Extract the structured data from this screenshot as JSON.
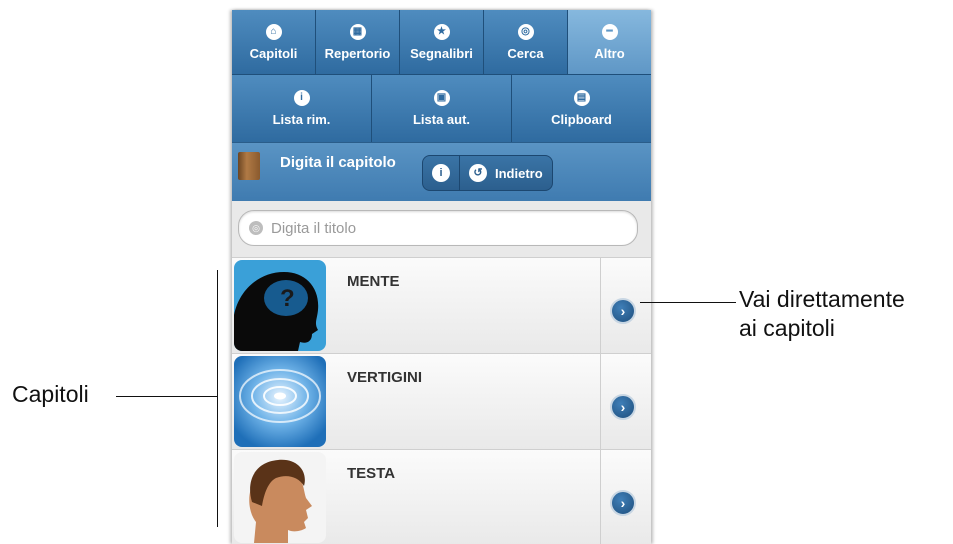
{
  "tabs_row1": [
    {
      "label": "Capitoli",
      "icon": "home-icon",
      "glyph": "⌂"
    },
    {
      "label": "Repertorio",
      "icon": "grid-icon",
      "glyph": "▦"
    },
    {
      "label": "Segnalibri",
      "icon": "star-icon",
      "glyph": "★"
    },
    {
      "label": "Cerca",
      "icon": "search-icon",
      "glyph": "◎"
    },
    {
      "label": "Altro",
      "icon": "minus-icon",
      "glyph": "━",
      "active": true
    }
  ],
  "tabs_row2": [
    {
      "label": "Lista rim.",
      "icon": "info-icon",
      "glyph": "i"
    },
    {
      "label": "Lista aut.",
      "icon": "contact-icon",
      "glyph": "▣"
    },
    {
      "label": "Clipboard",
      "icon": "clipboard-icon",
      "glyph": "▤"
    }
  ],
  "header": {
    "title": "Digita il capitolo",
    "info_glyph": "i",
    "back_glyph": "↺",
    "back_label": "Indietro"
  },
  "search": {
    "placeholder": "Digita il titolo",
    "icon_glyph": "◎"
  },
  "chapters": [
    {
      "title": "MENTE",
      "thumb": "head-question-image"
    },
    {
      "title": "VERTIGINI",
      "thumb": "spiral-image"
    },
    {
      "title": "TESTA",
      "thumb": "head-profile-image"
    }
  ],
  "chevron_glyph": "›",
  "annotations": {
    "right_line1": "Vai direttamente",
    "right_line2": "ai capitoli",
    "left": "Capitoli"
  },
  "colors": {
    "bar": "#3f7bb0",
    "active_tab": "#6fa5d1",
    "list_bg": "#f2f2f2"
  }
}
